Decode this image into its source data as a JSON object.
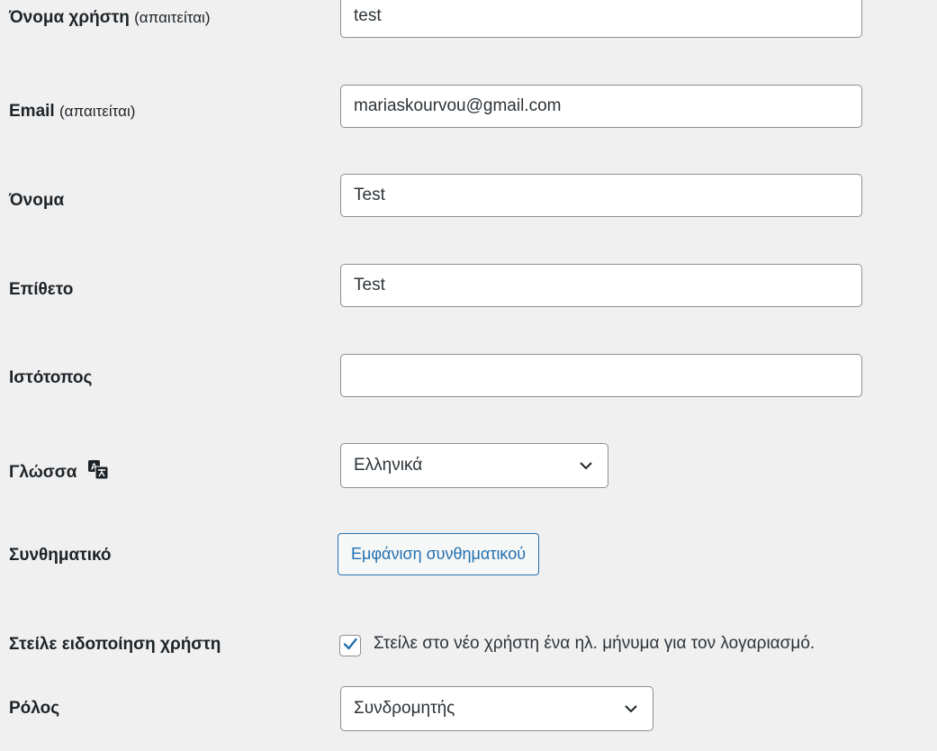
{
  "fields": {
    "username": {
      "label": "Όνομα χρήστη",
      "required": "(απαιτείται)",
      "value": "test"
    },
    "email": {
      "label": "Email",
      "required": "(απαιτείται)",
      "value": "mariaskourvou@gmail.com"
    },
    "first_name": {
      "label": "Όνομα",
      "value": "Test"
    },
    "last_name": {
      "label": "Επίθετο",
      "value": "Test"
    },
    "website": {
      "label": "Ιστότοπος",
      "value": ""
    },
    "language": {
      "label": "Γλώσσα",
      "icon": "translation-icon",
      "selected": "Ελληνικά"
    },
    "password": {
      "label": "Συνθηματικό",
      "button_label": "Εμφάνιση συνθηματικού"
    },
    "notify": {
      "label": "Στείλε ειδοποίηση χρήστη",
      "checkbox_label": "Στείλε στο νέο χρήστη ένα ηλ. μήνυμα για τον λογαριασμό.",
      "checked": true
    },
    "role": {
      "label": "Ρόλος",
      "selected": "Συνδρομητής"
    }
  },
  "colors": {
    "accent": "#2271b1",
    "border": "#8c8f94",
    "background": "#f0f0f1"
  }
}
